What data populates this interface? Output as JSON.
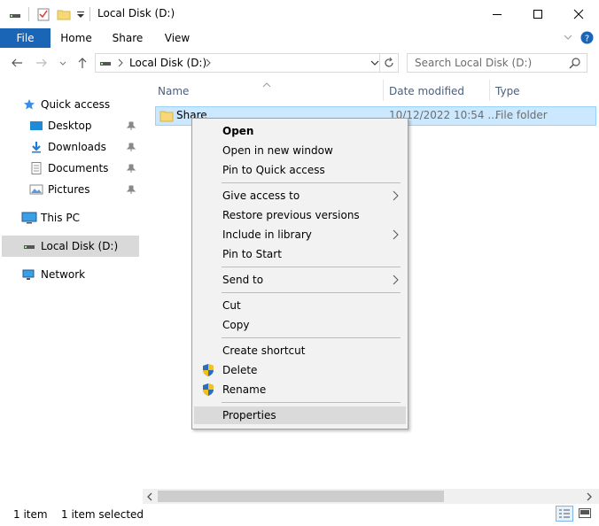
{
  "window": {
    "title": "Local Disk (D:)",
    "accent_color": "#1a65b6"
  },
  "ribbon": {
    "tabs": [
      "File",
      "Home",
      "Share",
      "View"
    ]
  },
  "address": {
    "path": "Local Disk (D:)",
    "search_placeholder": "Search Local Disk (D:)"
  },
  "nav": {
    "quick_access": "Quick access",
    "desktop": "Desktop",
    "downloads": "Downloads",
    "documents": "Documents",
    "pictures": "Pictures",
    "this_pc": "This PC",
    "local_disk": "Local Disk (D:)",
    "network": "Network"
  },
  "columns": {
    "name": "Name",
    "date_modified": "Date modified",
    "type": "Type"
  },
  "files": [
    {
      "name": "Share",
      "date_modified": "10/12/2022 10:54 ...",
      "type": "File folder"
    }
  ],
  "context_menu": {
    "open": "Open",
    "open_new_window": "Open in new window",
    "pin_quick_access": "Pin to Quick access",
    "give_access": "Give access to",
    "restore_versions": "Restore previous versions",
    "include_library": "Include in library",
    "pin_start": "Pin to Start",
    "send_to": "Send to",
    "cut": "Cut",
    "copy": "Copy",
    "create_shortcut": "Create shortcut",
    "delete": "Delete",
    "rename": "Rename",
    "properties": "Properties"
  },
  "status": {
    "item_count": "1 item",
    "selected": "1 item selected"
  }
}
